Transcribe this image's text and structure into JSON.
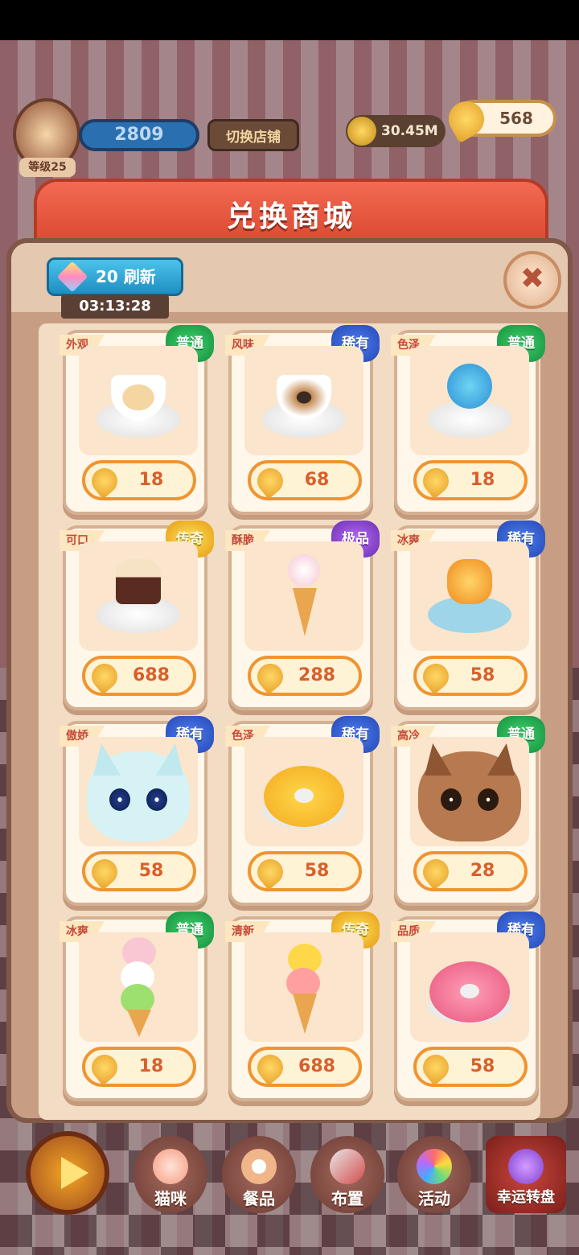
{
  "hud": {
    "shop_level": "等级25",
    "score": "2809",
    "switch_shop": "切换店铺",
    "coins": "30.45M",
    "fish": "568"
  },
  "modal": {
    "title": "兑换商城",
    "refresh_cost": "20",
    "refresh_label": "刷新",
    "timer": "03:13:28",
    "close_symbol": "✖"
  },
  "items": [
    {
      "tag": "外观",
      "rarity": "普通",
      "rarity_class": "common",
      "price": "18",
      "art": "flower-latte"
    },
    {
      "tag": "风味",
      "rarity": "稀有",
      "rarity_class": "rare",
      "price": "68",
      "art": "panda-latte"
    },
    {
      "tag": "色泽",
      "rarity": "普通",
      "rarity_class": "common",
      "price": "18",
      "art": "blue-cupcake"
    },
    {
      "tag": "可口",
      "rarity": "传奇",
      "rarity_class": "legend",
      "price": "688",
      "art": "bear-ice-cream-bar"
    },
    {
      "tag": "酥脆",
      "rarity": "极品",
      "rarity_class": "epic",
      "price": "288",
      "art": "cat-ice-cream-cone"
    },
    {
      "tag": "冰爽",
      "rarity": "稀有",
      "rarity_class": "rare",
      "price": "58",
      "art": "chick-popsicle"
    },
    {
      "tag": "傲娇",
      "rarity": "稀有",
      "rarity_class": "rare",
      "price": "58",
      "art": "blue-cat"
    },
    {
      "tag": "色泽",
      "rarity": "稀有",
      "rarity_class": "rare",
      "price": "58",
      "art": "yellow-donut"
    },
    {
      "tag": "高冷",
      "rarity": "普通",
      "rarity_class": "common",
      "price": "28",
      "art": "brown-cat"
    },
    {
      "tag": "冰爽",
      "rarity": "普通",
      "rarity_class": "common",
      "price": "18",
      "art": "triple-scoop-cone"
    },
    {
      "tag": "清新",
      "rarity": "传奇",
      "rarity_class": "legend",
      "price": "688",
      "art": "duck-ice-cream-cone"
    },
    {
      "tag": "品质",
      "rarity": "稀有",
      "rarity_class": "rare",
      "price": "58",
      "art": "pink-donut"
    }
  ],
  "nav": {
    "cats": "猫咪",
    "food": "餐品",
    "decor": "布置",
    "events": "活动",
    "lucky_wheel": "幸运转盘"
  },
  "colors": {
    "header_red": "#e0523b",
    "common_green": "#1ea94e",
    "rare_blue": "#2f5fd6",
    "legend_gold": "#f0b322",
    "epic_purple": "#8d45d4",
    "price_orange": "#f09431"
  }
}
